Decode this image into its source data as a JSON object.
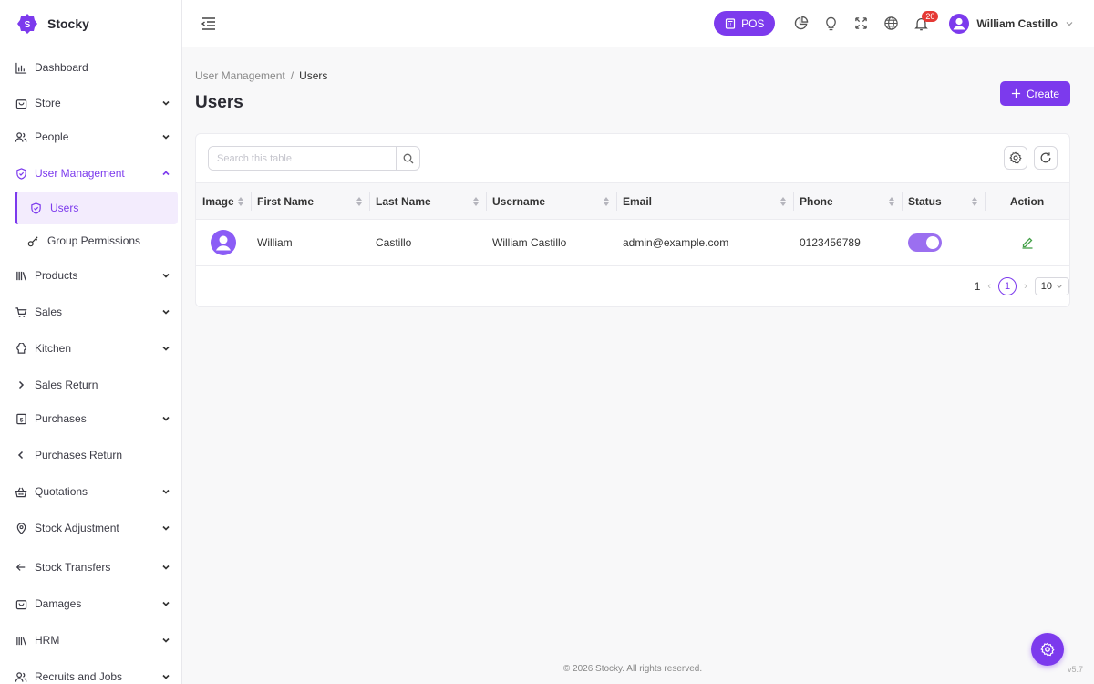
{
  "brand": {
    "name": "Stocky",
    "logo_letter": "S"
  },
  "sidebar": {
    "items": [
      {
        "label": "Dashboard",
        "icon": "bar-chart-icon"
      },
      {
        "label": "Store",
        "icon": "store-icon"
      },
      {
        "label": "People",
        "icon": "people-icon"
      },
      {
        "label": "User Management",
        "icon": "shield-icon"
      },
      {
        "label": "Products",
        "icon": "books-icon"
      },
      {
        "label": "Sales",
        "icon": "cart-icon"
      },
      {
        "label": "Kitchen",
        "icon": "chef-hat-icon"
      },
      {
        "label": "Sales Return",
        "icon": "chevron-right-icon"
      },
      {
        "label": "Purchases",
        "icon": "invoice-icon"
      },
      {
        "label": "Purchases Return",
        "icon": "chevron-left-icon"
      },
      {
        "label": "Quotations",
        "icon": "basket-icon"
      },
      {
        "label": "Stock Adjustment",
        "icon": "location-pin-icon"
      },
      {
        "label": "Stock Transfers",
        "icon": "arrow-left-icon"
      },
      {
        "label": "Damages",
        "icon": "box-icon"
      },
      {
        "label": "HRM",
        "icon": "library-icon"
      },
      {
        "label": "Recruits and Jobs",
        "icon": "people-icon"
      }
    ],
    "sub_items": [
      {
        "label": "Users",
        "icon": "shield-icon"
      },
      {
        "label": "Group Permissions",
        "icon": "key-icon"
      }
    ]
  },
  "topbar": {
    "pos_label": "POS",
    "notification_count": "20",
    "user_name": "William Castillo"
  },
  "page": {
    "breadcrumb_parent": "User Management",
    "breadcrumb_sep": "/",
    "breadcrumb_current": "Users",
    "title": "Users",
    "create_label": "Create"
  },
  "table": {
    "search_placeholder": "Search this table",
    "columns": [
      "Image",
      "First Name",
      "Last Name",
      "Username",
      "Email",
      "Phone",
      "Status",
      "Action"
    ],
    "rows": [
      {
        "first_name": "William",
        "last_name": "Castillo",
        "username": "William Castillo",
        "email": "admin@example.com",
        "phone": "0123456789",
        "status_on": true
      }
    ],
    "pagination": {
      "total": "1",
      "current_page": "1",
      "page_size": "10"
    }
  },
  "footer": {
    "copyright": "© 2026 Stocky. All rights reserved.",
    "version": "v5.7"
  },
  "colors": {
    "accent": "#7c3aed",
    "badge": "#e53935",
    "edit": "#43a047"
  }
}
